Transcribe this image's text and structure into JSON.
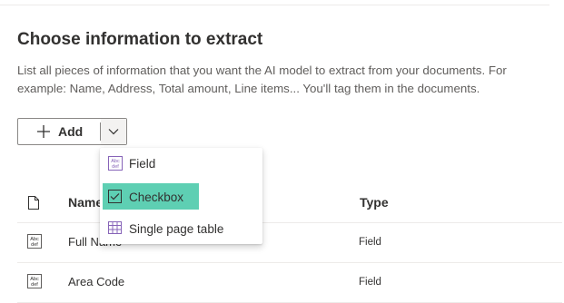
{
  "section": {
    "title": "Choose information to extract",
    "description": "List all pieces of information that you want the AI model to extract from your documents. For example: Name, Address, Total amount, Line items... You'll tag them in the documents."
  },
  "add_button": {
    "label": "Add",
    "icon": "plus-icon",
    "dropdown_icon": "chevron-down-icon"
  },
  "menu": {
    "items": [
      {
        "label": "Field",
        "icon": "abc-def-field-icon"
      },
      {
        "label": "Checkbox",
        "icon": "checkbox-icon",
        "highlighted": true,
        "highlight_color": "#5ecfb3"
      },
      {
        "label": "Single page table",
        "icon": "table-icon"
      }
    ]
  },
  "table": {
    "headers": {
      "icon": "file-icon",
      "name": "Name",
      "type": "Type"
    },
    "rows": [
      {
        "icon": "abc-def-field-icon",
        "name": "Full Name",
        "type": "Field"
      },
      {
        "icon": "abc-def-field-icon",
        "name": "Area Code",
        "type": "Field"
      }
    ]
  }
}
